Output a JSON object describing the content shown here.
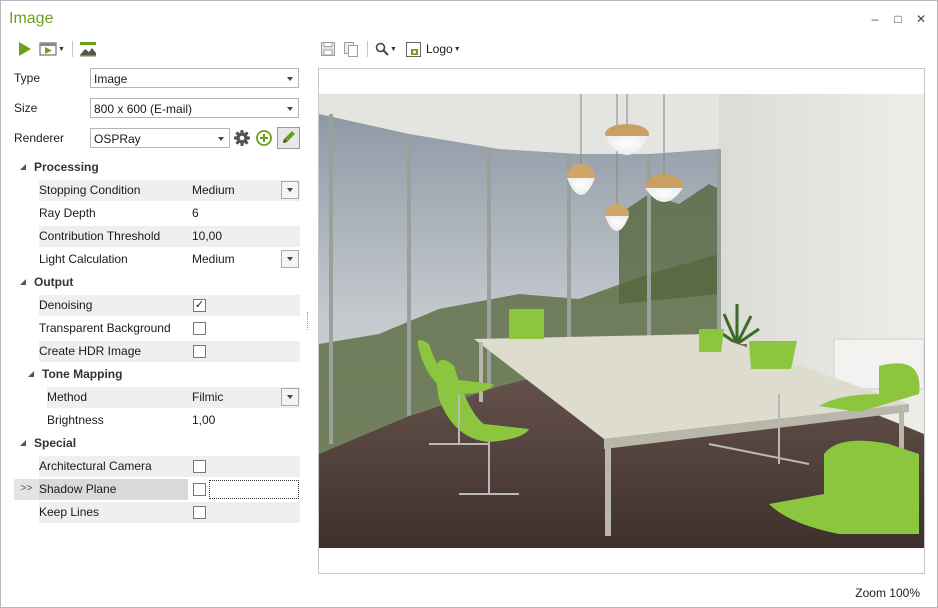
{
  "window": {
    "title": "Image",
    "minimize": "–",
    "maximize": "□",
    "close": "✕"
  },
  "left_toolbar": {
    "icons": [
      "play-icon",
      "render-options-icon",
      "image-settings-icon"
    ]
  },
  "right_toolbar": {
    "icons": [
      "save-icon",
      "copy-icon",
      "zoom-icon",
      "logo-icon"
    ],
    "logo_label": "Logo"
  },
  "fields": {
    "type_label": "Type",
    "type_value": "Image",
    "size_label": "Size",
    "size_value": "800 x 600 (E-mail)",
    "renderer_label": "Renderer",
    "renderer_value": "OSPRay"
  },
  "grid": {
    "processing": {
      "label": "Processing",
      "stopping_condition": {
        "name": "Stopping Condition",
        "value": "Medium"
      },
      "ray_depth": {
        "name": "Ray Depth",
        "value": "6"
      },
      "contribution_threshold": {
        "name": "Contribution Threshold",
        "value": "10,00"
      },
      "light_calculation": {
        "name": "Light Calculation",
        "value": "Medium"
      }
    },
    "output": {
      "label": "Output",
      "denoising": {
        "name": "Denoising",
        "checked": true,
        "mark": "✓"
      },
      "transparent_background": {
        "name": "Transparent Background",
        "checked": false
      },
      "create_hdr": {
        "name": "Create HDR Image",
        "checked": false
      }
    },
    "tone_mapping": {
      "label": "Tone Mapping",
      "method": {
        "name": "Method",
        "value": "Filmic"
      },
      "brightness": {
        "name": "Brightness",
        "value": "1,00"
      }
    },
    "special": {
      "label": "Special",
      "architectural_camera": {
        "name": "Architectural Camera",
        "checked": false
      },
      "shadow_plane": {
        "name": "Shadow Plane",
        "checked": false,
        "marker": ">>"
      },
      "keep_lines": {
        "name": "Keep Lines",
        "checked": false
      }
    }
  },
  "preview": {
    "zoom_label": "Zoom 100%"
  },
  "colors": {
    "accent_green": "#6aa01c",
    "chair_green": "#8cc63f"
  }
}
